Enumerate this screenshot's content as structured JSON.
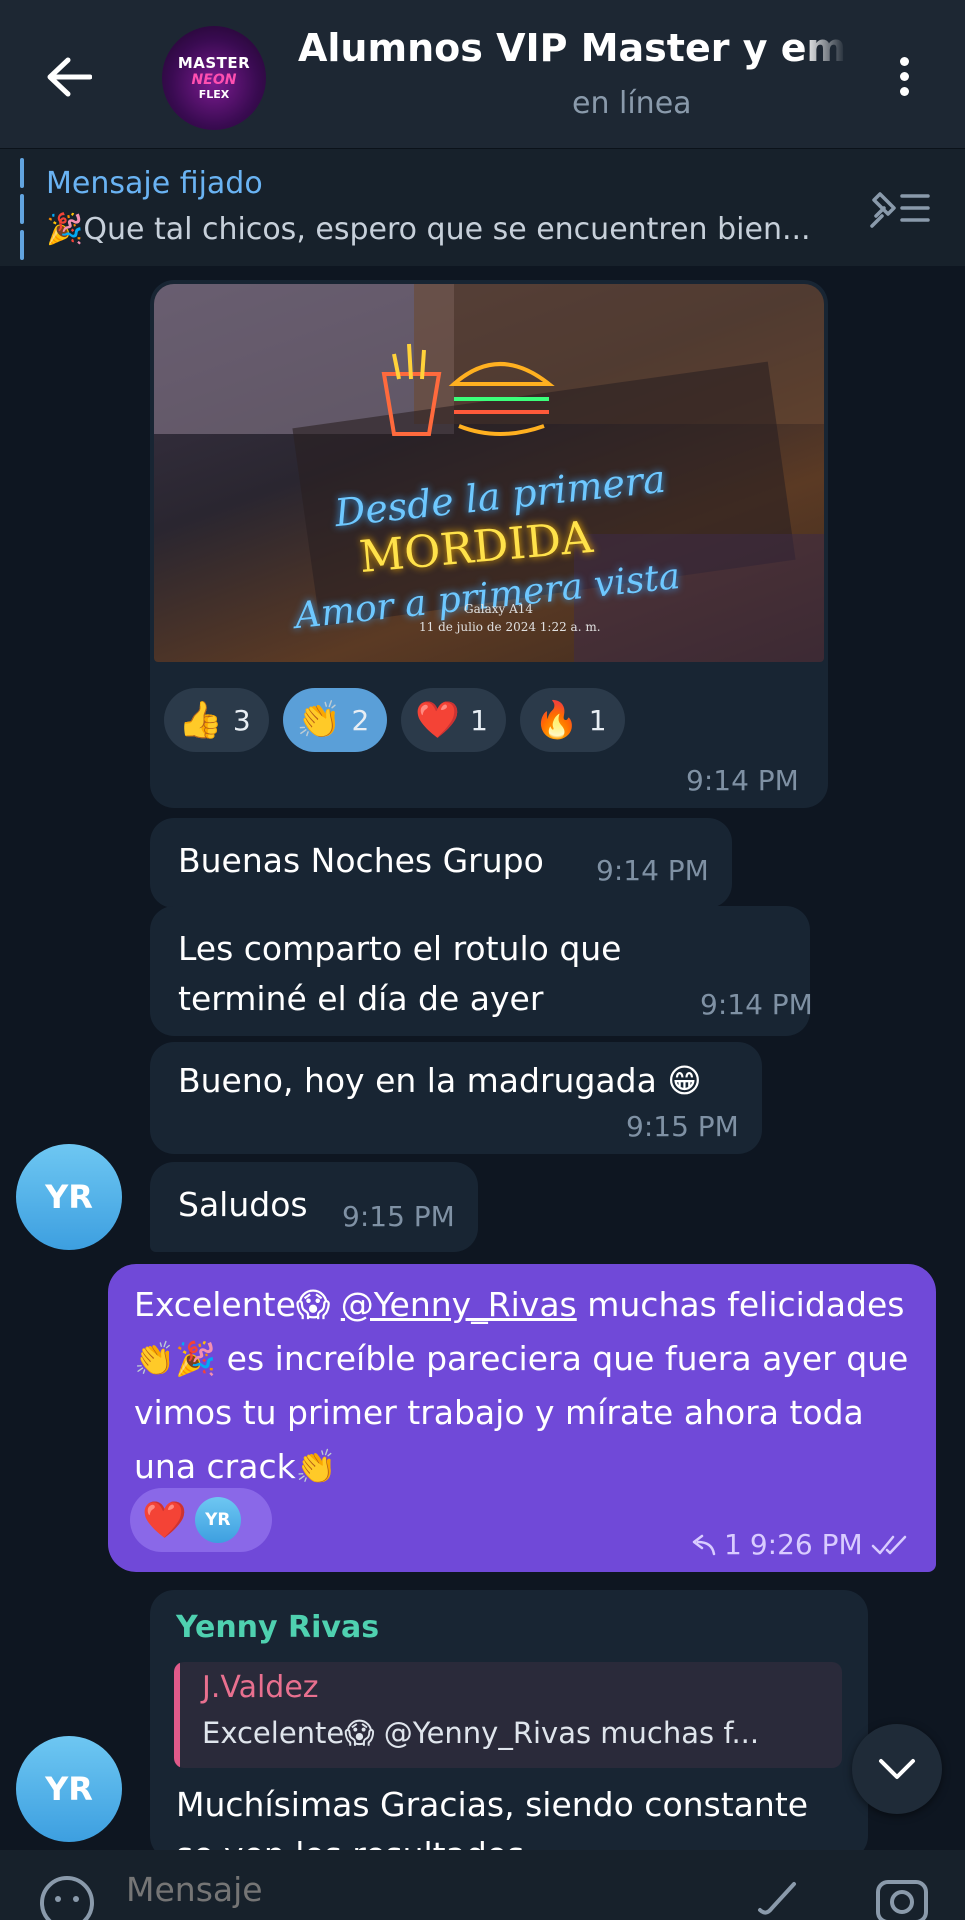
{
  "header": {
    "back_icon": "arrow-left-icon",
    "title": "Alumnos VIP Master y emp",
    "status": "en línea",
    "avatar": {
      "line1": "MASTER",
      "line2": "NEON",
      "line3": "FLEX"
    },
    "menu_icon": "more-vertical-icon"
  },
  "pinned": {
    "title": "Mensaje fijado",
    "text": "🎉Que tal chicos, espero que se encuentren bien..."
  },
  "messages": {
    "photo": {
      "neon_line1": "Desde la primera",
      "neon_line2": "MORDIDA",
      "neon_line3": "Amor a primera vista",
      "caption_small": "Galaxy A14",
      "caption_date": "11 de julio de 2024 1:22 a. m.",
      "reactions": [
        {
          "emoji": "👍",
          "count": "3"
        },
        {
          "emoji": "👏",
          "count": "2"
        },
        {
          "emoji": "❤️",
          "count": "1"
        },
        {
          "emoji": "🔥",
          "count": "1"
        }
      ],
      "time": "9:14 PM"
    },
    "m1": {
      "text": "Buenas Noches Grupo",
      "time": "9:14 PM"
    },
    "m2": {
      "text": "Les comparto el rotulo que terminé el día de ayer",
      "time": "9:14 PM"
    },
    "m3": {
      "text": "Bueno, hoy en la madrugada 😁",
      "time": "9:15 PM"
    },
    "m4": {
      "text": "Saludos",
      "time": "9:15 PM"
    },
    "avatar_initials": "YR",
    "outgoing": {
      "text_before": "Excelente😱 ",
      "mention": "@Yenny_Rivas",
      "text_after": " muchas felicidades 👏🎉 es increíble pareciera que fuera ayer que vimos tu primer trabajo y mírate ahora toda una crack👏",
      "reaction_emoji": "❤️",
      "reaction_avatar": "YR",
      "reply_count": "1",
      "time": "9:26 PM"
    },
    "reply": {
      "sender": "Yenny Rivas",
      "quote_name": "J.Valdez",
      "quote_text": "Excelente😱 @Yenny_Rivas muchas f...",
      "text": "Muchísimas Gracias, siendo constante se ven los resultados"
    }
  },
  "composer": {
    "placeholder": "Mensaje"
  }
}
